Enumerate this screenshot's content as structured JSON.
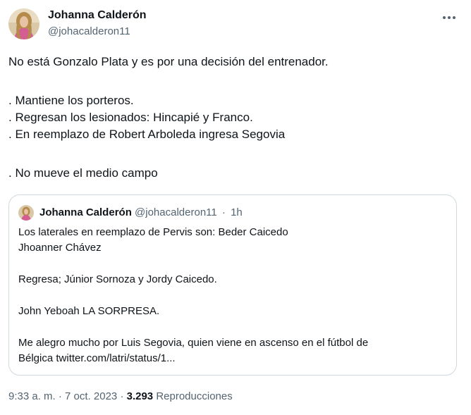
{
  "author": {
    "name": "Johanna Calderón",
    "handle": "@johacalderon11"
  },
  "tweet": {
    "lines": [
      "No está Gonzalo Plata y es por una decisión del entrenador.",
      "",
      ". Mantiene los porteros.",
      ". Regresan los lesionados: Hincapié y Franco.",
      ". En reemplazo de Robert Arboleda ingresa Segovia",
      "",
      ". No mueve el medio campo"
    ]
  },
  "quoted": {
    "name": "Johanna Calderón",
    "handle": "@johacalderon11",
    "separator": "·",
    "time": "1h",
    "lines": [
      "Los laterales en reemplazo de Pervis son: Beder Caicedo",
      "Jhoanner Chávez",
      "",
      "Regresa; Júnior Sornoza y Jordy Caicedo.",
      "",
      "John Yeboah LA SORPRESA.",
      "",
      "Me alegro mucho por Luis Segovia, quien viene en ascenso en el fútbol de",
      "Bélgica twitter.com/latri/status/1..."
    ]
  },
  "meta": {
    "timestamp": "9:33 a. m. · 7 oct. 2023",
    "separator": "·",
    "view_count": "3.293",
    "views_label": "Reproducciones"
  },
  "icons": {
    "more": "more-horizontal-icon"
  },
  "colors": {
    "text": "#0f1419",
    "secondary": "#536471",
    "border": "#cfd9de"
  }
}
